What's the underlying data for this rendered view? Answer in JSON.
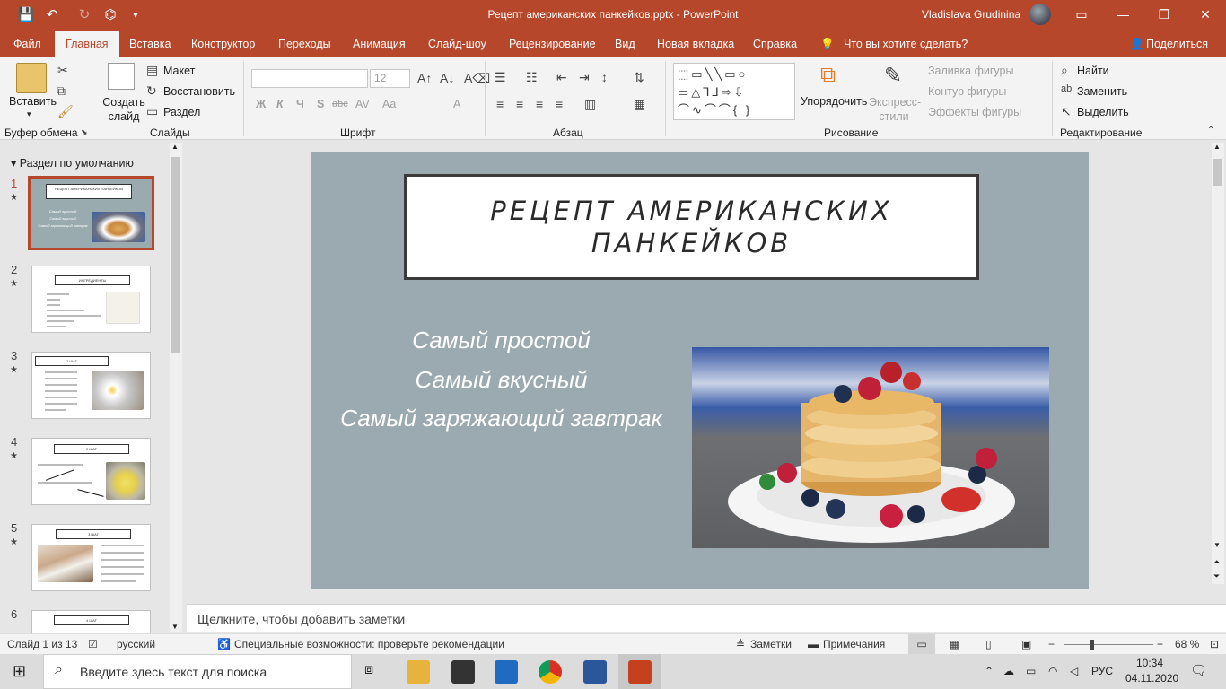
{
  "window": {
    "doc_title": "Рецепт американских панкейков.pptx  -  PowerPoint",
    "user": "Vladislava Grudinina",
    "qat": [
      "💾",
      "↶",
      "↻",
      "⌬",
      "▾"
    ],
    "win_controls": [
      "▭",
      "—",
      "❐",
      "✕"
    ]
  },
  "tabs": [
    "Файл",
    "Главная",
    "Вставка",
    "Конструктор",
    "Переходы",
    "Анимация",
    "Слайд-шоу",
    "Рецензирование",
    "Вид",
    "Новая вкладка",
    "Справка",
    "Что вы хотите сделать?",
    "Поделиться"
  ],
  "ribbon": {
    "clipboard": {
      "paste": "Вставить",
      "label": "Буфер обмена"
    },
    "slides": {
      "new_slide": "Создать слайд",
      "layout": "Макет",
      "reset": "Восстановить",
      "section": "Раздел",
      "label": "Слайды"
    },
    "font": {
      "font_size": "12",
      "label": "Шрифт",
      "format_buttons": [
        "Ж",
        "К",
        "Ч",
        "S",
        "abc",
        "AV",
        "Aa",
        "A"
      ]
    },
    "paragraph": {
      "label": "Абзац"
    },
    "drawing": {
      "arrange": "Упорядочить",
      "quick_styles": "Экспресс-стили",
      "fill": "Заливка фигуры",
      "outline": "Контур фигуры",
      "effects": "Эффекты фигуры",
      "label": "Рисование",
      "shapes_gallery": "⬚▭╲╲▭○ ▭△⅂⅃⇨⇩ ⌒∿⌒⌒{ }"
    },
    "editing": {
      "find": "Найти",
      "replace": "Заменить",
      "select": "Выделить",
      "label": "Редактирование"
    }
  },
  "thumbnails": {
    "section": "Раздел по умолчанию",
    "slides": [
      {
        "num": "1",
        "title": "РЕЦЕПТ АМЕРИКАНСКИХ ПАНКЕЙКОВ",
        "lines": [
          "Самый простой",
          "Самый вкусный",
          "Самый заряжающий завтрак"
        ]
      },
      {
        "num": "2",
        "title": "ИНГРЕДИЕНТЫ"
      },
      {
        "num": "3",
        "title": "1 ШАГ"
      },
      {
        "num": "4",
        "title": "2 ШАГ"
      },
      {
        "num": "5",
        "title": "3 ШАГ"
      },
      {
        "num": "6",
        "title": "4 ШАГ"
      }
    ]
  },
  "slide": {
    "title_line1": "РЕЦЕПТ АМЕРИКАНСКИХ",
    "title_line2": "ПАНКЕЙКОВ",
    "sub1": "Самый простой",
    "sub2": "Самый вкусный",
    "sub3": "Самый заряжающий завтрак",
    "image": "pancake-stack-photo"
  },
  "notes_placeholder": "Щелкните, чтобы добавить заметки",
  "status": {
    "slide_count": "Слайд 1 из 13",
    "language": "русский",
    "accessibility": "Специальные возможности: проверьте рекомендации",
    "notes": "Заметки",
    "comments": "Примечания",
    "zoom": "68 %",
    "zoom_level_pct": 68
  },
  "taskbar": {
    "search_placeholder": "Введите здесь текст для поиска",
    "lang": "РУС",
    "time": "10:34",
    "date": "04.11.2020"
  },
  "colors": {
    "accent": "#b7472a",
    "slide_bg": "#9baab0"
  }
}
